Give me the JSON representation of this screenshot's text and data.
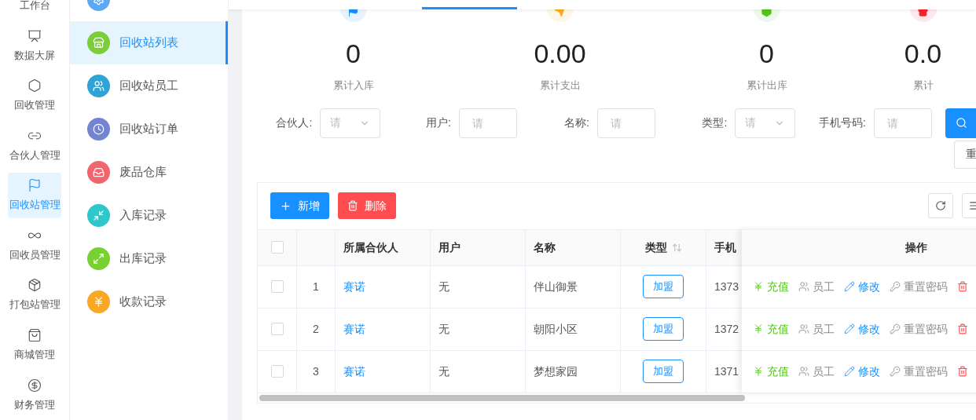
{
  "rail": [
    {
      "label": "工作台",
      "selected": false
    },
    {
      "label": "数据大屏",
      "selected": false
    },
    {
      "label": "回收管理",
      "selected": false
    },
    {
      "label": "合伙人管理",
      "selected": false
    },
    {
      "label": "回收站管理",
      "selected": true
    },
    {
      "label": "回收员管理",
      "selected": false
    },
    {
      "label": "打包站管理",
      "selected": false
    },
    {
      "label": "商城管理",
      "selected": false
    },
    {
      "label": "财务管理",
      "selected": false
    }
  ],
  "submenu": [
    {
      "selected": false,
      "color": "#5ca8f5"
    },
    {
      "label": "回收站列表",
      "selected": true,
      "color": "#7ccd3a"
    },
    {
      "label": "回收站员工",
      "selected": false,
      "color": "#2fa3d6"
    },
    {
      "label": "回收站订单",
      "selected": false,
      "color": "#7384d0"
    },
    {
      "label": "废品仓库",
      "selected": false,
      "color": "#f0656e"
    },
    {
      "label": "入库记录",
      "selected": false,
      "color": "#2ec8cc"
    },
    {
      "label": "出库记录",
      "selected": false,
      "color": "#77d130"
    },
    {
      "label": "收款记录",
      "selected": false,
      "color": "#f9a825"
    }
  ],
  "stats": [
    {
      "value": "0",
      "label": "累计入库",
      "color": "#1890ff"
    },
    {
      "value": "0.00",
      "label": "累计支出",
      "color": "#faad14"
    },
    {
      "value": "0",
      "label": "累计出库",
      "color": "#52c41a"
    },
    {
      "value": "0.0",
      "label": "累计",
      "color": "#f5222d"
    }
  ],
  "filters": [
    {
      "label": "合伙人:",
      "kind": "select",
      "placeholder": "请"
    },
    {
      "label": "用户:",
      "kind": "input",
      "placeholder": "请"
    },
    {
      "label": "名称:",
      "kind": "input",
      "placeholder": "请"
    },
    {
      "label": "类型:",
      "kind": "select",
      "placeholder": "请"
    },
    {
      "label": "手机号码:",
      "kind": "input",
      "placeholder": "请"
    }
  ],
  "reset_button": "重",
  "toolbar": {
    "add": "新增",
    "delete": "删除"
  },
  "table": {
    "columns": [
      "所属合伙人",
      "用户",
      "名称",
      "类型",
      "手机"
    ],
    "actions_column": "操作",
    "header_checked": false,
    "rows": [
      {
        "checked": false,
        "index": "1",
        "partner": "赛诺",
        "user": "无",
        "name": "伴山御景",
        "type": "加盟",
        "phone": "1373",
        "actions": [
          {
            "kind": "recharge",
            "label": "充值"
          },
          {
            "kind": "staff",
            "label": "员工"
          },
          {
            "kind": "edit",
            "label": "修改"
          },
          {
            "kind": "reset",
            "label": "重置密码"
          }
        ]
      },
      {
        "checked": false,
        "index": "2",
        "partner": "赛诺",
        "user": "无",
        "name": "朝阳小区",
        "type": "加盟",
        "phone": "1372",
        "actions": [
          {
            "kind": "recharge",
            "label": "充值"
          },
          {
            "kind": "staff",
            "label": "员工"
          },
          {
            "kind": "edit",
            "label": "修改"
          },
          {
            "kind": "reset",
            "label": "重置密码"
          }
        ]
      },
      {
        "checked": false,
        "index": "3",
        "partner": "赛诺",
        "user": "无",
        "name": "梦想家园",
        "type": "加盟",
        "phone": "1371",
        "actions": [
          {
            "kind": "recharge",
            "label": "充值"
          },
          {
            "kind": "staff",
            "label": "员工"
          },
          {
            "kind": "edit",
            "label": "修改"
          },
          {
            "kind": "reset",
            "label": "重置密码"
          }
        ]
      }
    ]
  }
}
